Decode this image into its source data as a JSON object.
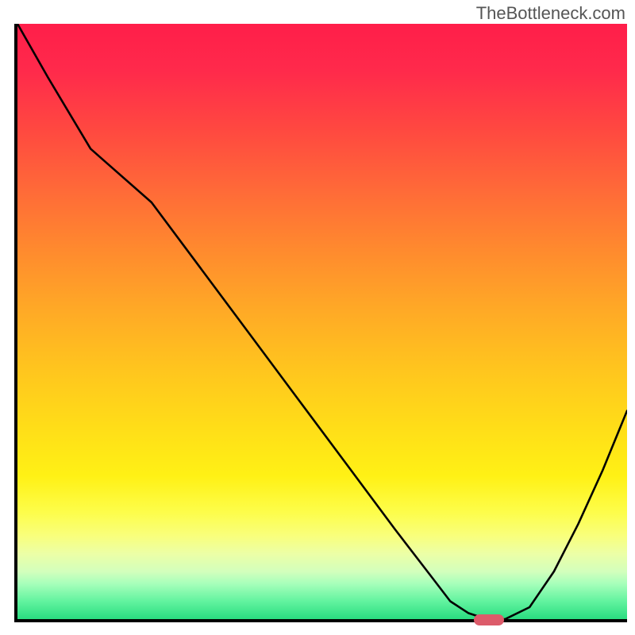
{
  "branding": {
    "watermark": "TheBottleneck.com"
  },
  "chart_data": {
    "type": "line",
    "title": "",
    "xlabel": "",
    "ylabel": "",
    "xlim": [
      0,
      100
    ],
    "ylim": [
      0,
      100
    ],
    "x": [
      0,
      5,
      12,
      22,
      30,
      38,
      46,
      54,
      62,
      68,
      71,
      74,
      77,
      80,
      84,
      88,
      92,
      96,
      100
    ],
    "values": [
      100,
      91,
      79,
      70,
      59,
      48,
      37,
      26,
      15,
      7,
      3,
      1,
      0,
      0,
      2,
      8,
      16,
      25,
      35
    ],
    "marker": {
      "x": 77,
      "y": 0
    },
    "annotations": [],
    "grid": false,
    "legend": false,
    "background_gradient": {
      "orientation": "vertical",
      "stops": [
        {
          "pos": 0.0,
          "color": "#ff1e4a"
        },
        {
          "pos": 0.18,
          "color": "#ff4940"
        },
        {
          "pos": 0.38,
          "color": "#ff8a2e"
        },
        {
          "pos": 0.58,
          "color": "#ffc51e"
        },
        {
          "pos": 0.76,
          "color": "#fff115"
        },
        {
          "pos": 0.89,
          "color": "#ecffa6"
        },
        {
          "pos": 1.0,
          "color": "#29dc80"
        }
      ]
    }
  }
}
